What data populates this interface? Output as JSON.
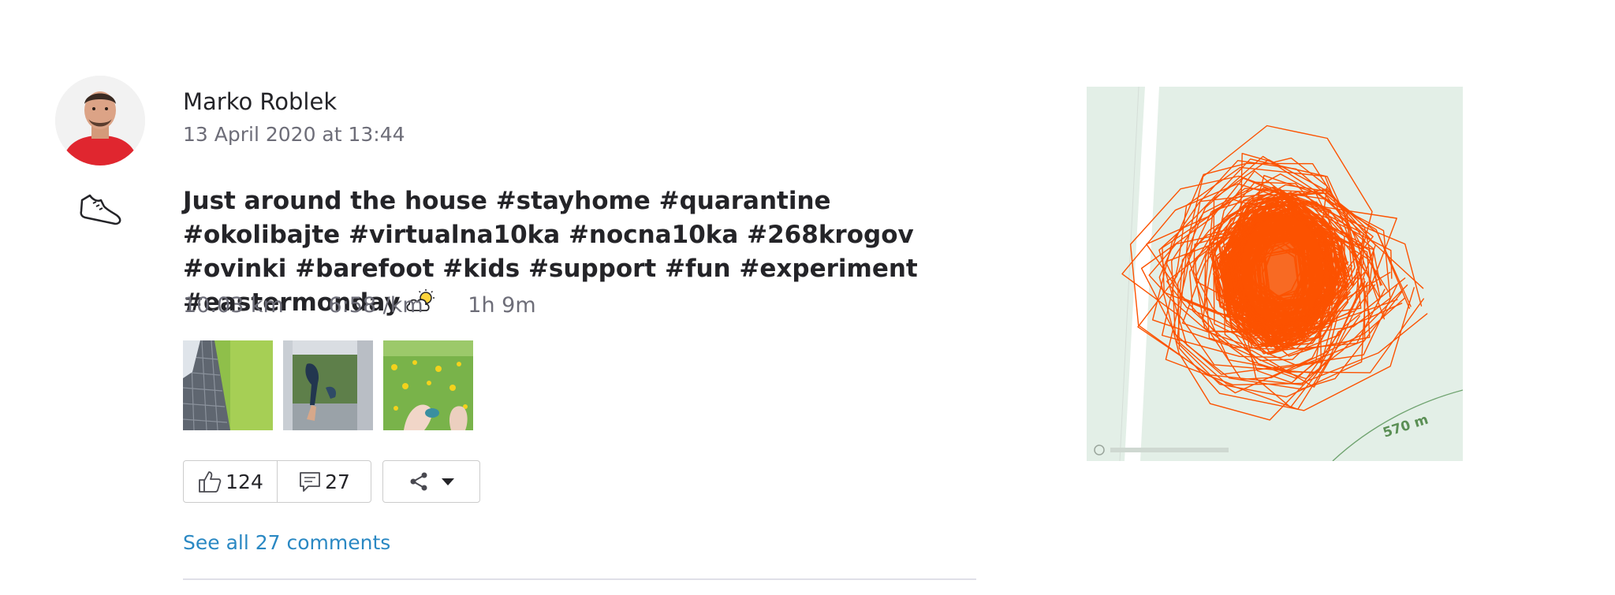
{
  "athlete": {
    "name": "Marko Roblek"
  },
  "activity": {
    "date": "13 April 2020 at 13:44",
    "title": "Just around the house #stayhome #quarantine #okolibajte #virtualna10ka #nocna10ka #268krogov #ovinki #barefoot #kids #support #fun #experiment #eastermonday",
    "sport_icon": "shoe-icon",
    "weather_icon": "partly-cloudy-icon",
    "stats": {
      "distance": "10.03 km",
      "pace": "6:58 /km",
      "time": "1h 9m"
    },
    "photos": [
      "photo-1",
      "photo-2",
      "photo-3"
    ]
  },
  "actions": {
    "kudos_count": "124",
    "comment_count": "27",
    "share_icon": "share-icon",
    "see_comments": "See all 27 comments"
  },
  "map": {
    "scale_label": "570 m",
    "route_color": "#fc5200"
  },
  "colors": {
    "link": "#2a88c3",
    "muted": "#6d6d78",
    "route": "#fc5200"
  }
}
